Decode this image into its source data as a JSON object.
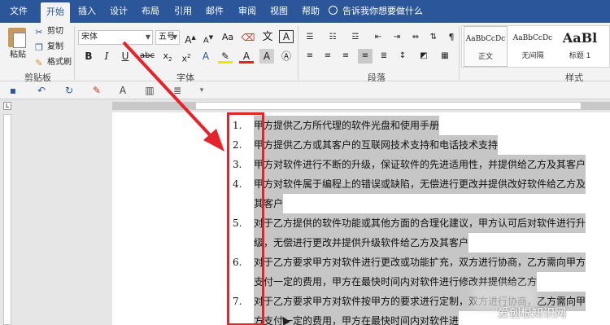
{
  "tabs": [
    "文件",
    "开始",
    "插入",
    "设计",
    "布局",
    "引用",
    "邮件",
    "审阅",
    "视图",
    "帮助"
  ],
  "active_tab": "开始",
  "tell_me": "告诉我你想要做什么",
  "clipboard": {
    "paste_label": "粘贴",
    "cut_label": "剪切",
    "copy_label": "复制",
    "format_painter_label": "格式刷",
    "group_label": "剪贴板"
  },
  "font": {
    "font_name": "宋体",
    "font_size": "五号",
    "group_label": "字体"
  },
  "paragraph": {
    "group_label": "段落"
  },
  "styles": {
    "group_label": "样式",
    "items": [
      {
        "preview": "AaBbCcDc",
        "name": "正文"
      },
      {
        "preview": "AaBbCcDc",
        "name": "无间隔"
      },
      {
        "preview": "AaBl",
        "name": "标题 1"
      }
    ]
  },
  "document": {
    "items": [
      {
        "num": "1.",
        "lines": [
          "甲方提供乙方所代理的软件光盘和使用手册"
        ]
      },
      {
        "num": "2.",
        "lines": [
          "甲方提供乙方或其客户的互联网技术支持和电话技术支持"
        ]
      },
      {
        "num": "3.",
        "lines": [
          "甲方对软件进行不断的升级，保证软件的先进适用性，并提供给乙方及其客户"
        ]
      },
      {
        "num": "4.",
        "lines": [
          "甲方对软件属于编程上的错误或缺陷，无偿进行更改并提供改好软件给乙方及",
          "其客户"
        ]
      },
      {
        "num": "5.",
        "lines": [
          "对于乙方提供的软件功能或其他方面的合理化建议，甲方认可后对软件进行升",
          "级，无偿进行更改并提供升级软件给乙方及其客户"
        ]
      },
      {
        "num": "6.",
        "lines": [
          "对于乙方要求甲方对软件进行更改或功能扩充，双方进行协商，乙方需向甲方",
          "支付一定的费用，甲方在最快时间内对软件进行修改并提供给乙方"
        ]
      },
      {
        "num": "7.",
        "lines": [
          "对于乙方要求甲方对软件按甲方的要求进行定制，双方进行协商，乙方需向甲",
          "方支付一定的费用，甲方在最快时间内对软件进"
        ]
      }
    ]
  },
  "watermark": "爱创根知识网",
  "colors": {
    "accent": "#2b579a",
    "highlight": "#c6c6c6",
    "annotation": "#e6232a"
  }
}
